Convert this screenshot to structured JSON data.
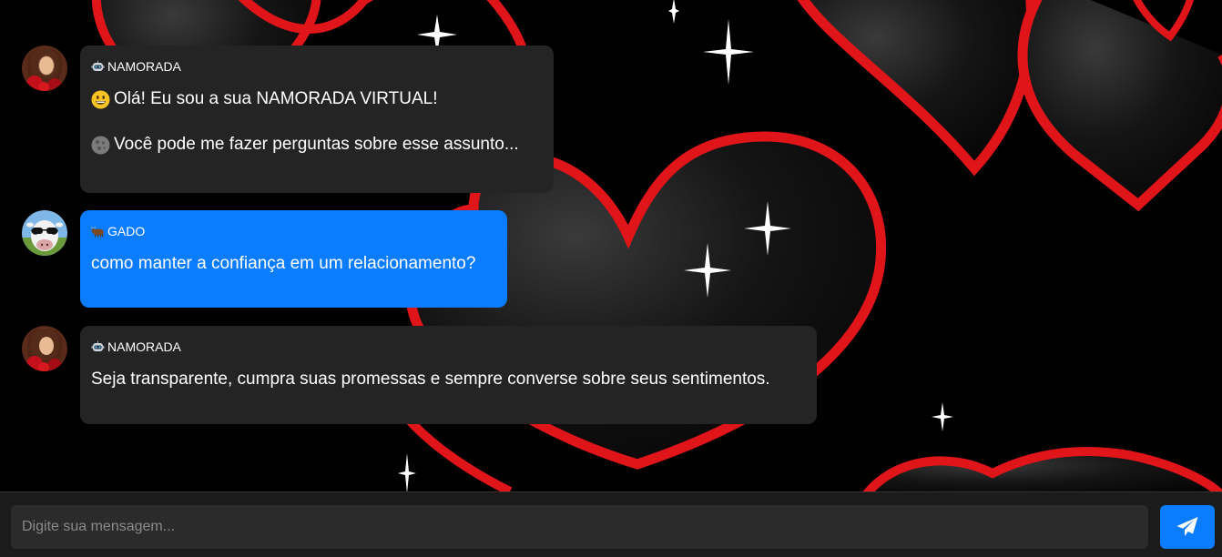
{
  "messages": [
    {
      "role": "bot",
      "sender": "NAMORADA",
      "sender_icon": "robot-icon",
      "lines": [
        {
          "icon": "grinning-face-icon",
          "text": "Olá! Eu sou a sua NAMORADA VIRTUAL!"
        },
        {
          "icon": "moon-icon",
          "text": "Você pode me fazer perguntas sobre esse assunto..."
        }
      ]
    },
    {
      "role": "user",
      "sender": "GADO",
      "sender_icon": "ox-icon",
      "lines": [
        {
          "text": "como manter a confiança em um relacionamento?"
        }
      ]
    },
    {
      "role": "bot",
      "sender": "NAMORADA",
      "sender_icon": "robot-icon",
      "lines": [
        {
          "text": "Seja transparente, cumpra suas promessas e sempre converse sobre seus sentimentos."
        }
      ]
    }
  ],
  "composer": {
    "placeholder": "Digite sua mensagem...",
    "send_icon": "paper-plane-icon"
  },
  "colors": {
    "bot_bubble": "#242424",
    "user_bubble": "#0a7cff",
    "accent": "#0a7cff",
    "heart": "#e0151a"
  }
}
